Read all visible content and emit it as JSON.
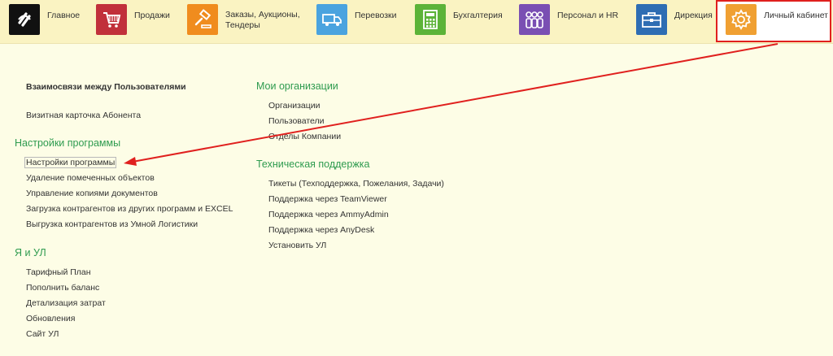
{
  "nav": {
    "items": [
      {
        "label": "Главное",
        "icon": "logo-icon",
        "color": "#111111"
      },
      {
        "label": "Продажи",
        "icon": "cart-icon",
        "color": "#c1303b"
      },
      {
        "label": "Заказы,  Аукционы,",
        "label2": "Тендеры",
        "icon": "gavel-icon",
        "color": "#f08c1e"
      },
      {
        "label": "Перевозки",
        "icon": "truck-icon",
        "color": "#4aa3df"
      },
      {
        "label": "Бухгалтерия",
        "icon": "calculator-icon",
        "color": "#5cb338"
      },
      {
        "label": "Персонал и HR",
        "icon": "people-icon",
        "color": "#7a4fb3"
      },
      {
        "label": "Дирекция",
        "icon": "briefcase-icon",
        "color": "#2e6db3"
      },
      {
        "label": "Личный кабинет",
        "icon": "gear-icon",
        "color": "#f0a032"
      }
    ],
    "active": "Личный кабинет",
    "highlight_color": "#e0201e"
  },
  "left": {
    "header_link": "Взаимосвязи между Пользователями",
    "card_link": "Визитная карточка Абонента",
    "settings_title": "Настройки программы",
    "settings_links": [
      "Настройки программы",
      "Удаление помеченных объектов",
      "Управление копиями документов",
      "Загрузка контрагентов из других программ и EXCEL",
      "Выгрузка контрагентов из Умной Логистики"
    ],
    "ul_title": "Я и УЛ",
    "ul_links": [
      "Тарифный План",
      "Пополнить баланс",
      "Детализация затрат",
      "Обновления",
      "Сайт УЛ"
    ]
  },
  "right": {
    "org_title": "Мои организации",
    "org_links": [
      "Организации",
      "Пользователи",
      "Отделы Компании"
    ],
    "support_title": "Техническая поддержка",
    "support_links": [
      "Тикеты (Техподдержка, Пожелания, Задачи)",
      "Поддержка через TeamViewer",
      "Поддержка через AmmyAdmin",
      "Поддержка через AnyDesk",
      "Установить УЛ"
    ]
  },
  "colors": {
    "section": "#2e9b4f",
    "background": "#fdfde6",
    "topbar": "#faf3c2",
    "arrow": "#e0201e"
  }
}
